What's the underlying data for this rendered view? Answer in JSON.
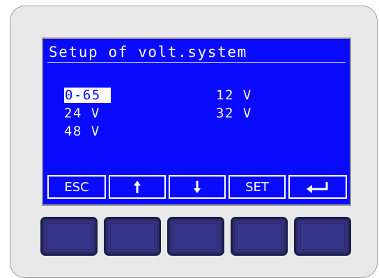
{
  "display": {
    "title": "Setup of volt.system",
    "options": [
      {
        "label": "0-65 ",
        "selected": true
      },
      {
        "label": "24 V",
        "selected": false
      },
      {
        "label": "48 V",
        "selected": false
      },
      {
        "label": "12 V",
        "selected": false
      },
      {
        "label": "32 V",
        "selected": false
      }
    ],
    "softkeys": {
      "esc": "ESC",
      "set": "SET"
    }
  },
  "colors": {
    "screen_bg": "#0a0aff",
    "screen_fg": "#ffffff",
    "device_bg": "#e9e9e9",
    "hardware_key": "#33337f"
  },
  "icons": {
    "up": "arrow-up-icon",
    "down": "arrow-down-icon",
    "enter": "enter-icon"
  }
}
